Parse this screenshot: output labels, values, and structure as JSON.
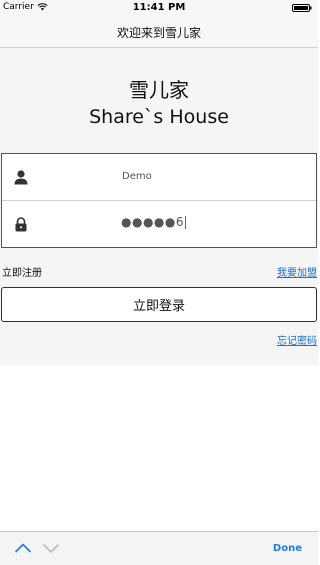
{
  "status_bar": {
    "carrier": "Carrier",
    "time": "11:41 PM"
  },
  "nav": {
    "title": "欢迎来到雪儿家"
  },
  "header": {
    "title_cn": "雪儿家",
    "title_en": "Share`s House"
  },
  "form": {
    "username_value": "Demo",
    "username_icon": "person-icon",
    "password_value": "●●●●●6",
    "password_icon": "lock-icon"
  },
  "links": {
    "register": "立即注册",
    "join": "我要加盟",
    "forgot": "忘记密码"
  },
  "login_button": "立即登录",
  "accessory": {
    "done": "Done",
    "prev_icon": "chevron-up-icon",
    "next_icon": "chevron-down-icon"
  },
  "colors": {
    "link": "#1a6ee0",
    "done": "#2a78d8",
    "background": "#f5f5f5"
  }
}
